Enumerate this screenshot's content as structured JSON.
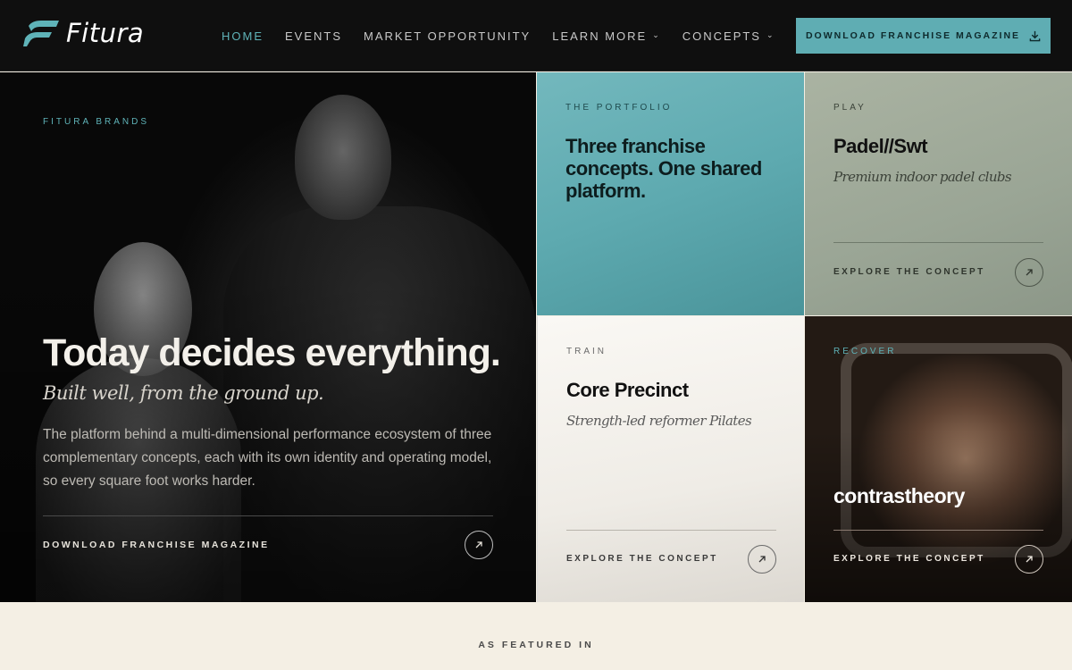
{
  "header": {
    "logo_text": "Fitura",
    "nav": [
      {
        "label": "HOME",
        "active": true,
        "dropdown": false
      },
      {
        "label": "EVENTS",
        "active": false,
        "dropdown": false
      },
      {
        "label": "MARKET OPPORTUNITY",
        "active": false,
        "dropdown": false
      },
      {
        "label": "LEARN MORE",
        "active": false,
        "dropdown": true
      },
      {
        "label": "CONCEPTS",
        "active": false,
        "dropdown": true
      }
    ],
    "cta_label": "DOWNLOAD FRANCHISE MAGAZINE",
    "cta_icon": "download-icon"
  },
  "hero": {
    "eyebrow": "FITURA BRANDS",
    "title": "Today decides everything.",
    "subtitle": "Built well, from the ground up.",
    "body": "The platform behind a multi-dimensional performance ecosystem of three complementary concepts, each with its own identity and operating model, so every square foot works harder.",
    "link_label": "DOWNLOAD FRANCHISE MAGAZINE",
    "link_icon": "arrow-up-right-icon"
  },
  "tiles": {
    "portfolio": {
      "eyebrow": "THE PORTFOLIO",
      "title": "Three franchise concepts. One shared platform."
    },
    "play": {
      "eyebrow": "PLAY",
      "title": "Padel//Swt",
      "subtitle": "Premium indoor padel clubs",
      "link_label": "EXPLORE THE CONCEPT"
    },
    "train": {
      "eyebrow": "TRAIN",
      "title": "Core Precinct",
      "subtitle": "Strength-led reformer Pilates",
      "link_label": "EXPLORE THE CONCEPT"
    },
    "recover": {
      "eyebrow": "RECOVER",
      "title": "contrastheory",
      "link_label": "EXPLORE THE CONCEPT"
    }
  },
  "featured": {
    "label": "AS FEATURED IN"
  },
  "colors": {
    "accent": "#5fadb3",
    "header_bg": "#0f0f0f",
    "cream": "#f4efe4"
  }
}
